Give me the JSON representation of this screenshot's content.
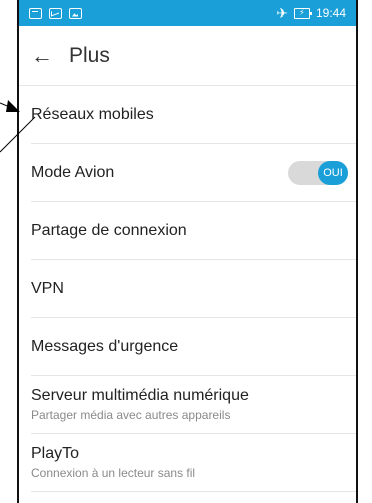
{
  "status_bar": {
    "time": "19:44",
    "left_icons": [
      "calendar-icon",
      "mail-icon",
      "photo-icon"
    ],
    "right_icons": [
      "airplane-icon",
      "battery-charging-icon"
    ],
    "background": "#1a9fd8"
  },
  "header": {
    "back_glyph": "←",
    "title": "Plus"
  },
  "items": [
    {
      "title": "Réseaux mobiles",
      "subtitle": ""
    },
    {
      "title": "Mode Avion",
      "subtitle": "",
      "toggle_label": "OUI",
      "toggle_on": true
    },
    {
      "title": "Partage de connexion",
      "subtitle": ""
    },
    {
      "title": "VPN",
      "subtitle": ""
    },
    {
      "title": "Messages d'urgence",
      "subtitle": ""
    },
    {
      "title": "Serveur multimédia numérique",
      "subtitle": "Partager média avec autres appareils"
    },
    {
      "title": "PlayTo",
      "subtitle": "Connexion à un lecteur sans fil"
    }
  ],
  "colors": {
    "accent": "#1a9fd8",
    "divider": "#e6e6e6",
    "subtitle": "#8a8a8a"
  }
}
